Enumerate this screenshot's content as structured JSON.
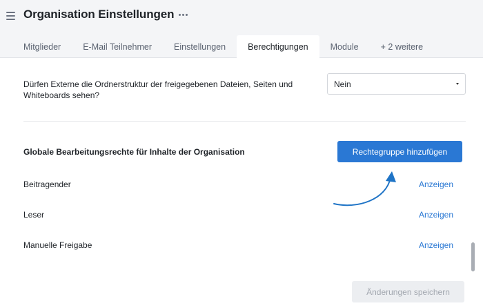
{
  "header": {
    "title": "Organisation Einstellungen",
    "menu_icon": "hamburger-menu-icon",
    "more_icon": "more-horizontal-icon"
  },
  "tabs": [
    {
      "label": "Mitglieder",
      "active": false
    },
    {
      "label": "E-Mail Teilnehmer",
      "active": false
    },
    {
      "label": "Einstellungen",
      "active": false
    },
    {
      "label": "Berechtigungen",
      "active": true
    },
    {
      "label": "Module",
      "active": false
    },
    {
      "label": "+ 2 weitere",
      "active": false
    }
  ],
  "external_structure": {
    "question": "Dürfen Externe die Ordnerstruktur der freigegebenen Dateien, Seiten und Whiteboards sehen?",
    "select_value": "Nein"
  },
  "rights": {
    "section_title": "Globale Bearbeitungsrechte für Inhalte der Organisation",
    "add_button_label": "Rechtegruppe hinzufügen",
    "groups": [
      {
        "label": "Beitragender",
        "action": "Anzeigen"
      },
      {
        "label": "Leser",
        "action": "Anzeigen"
      },
      {
        "label": "Manuelle Freigabe",
        "action": "Anzeigen"
      }
    ]
  },
  "footer": {
    "save_label": "Änderungen speichern",
    "save_disabled": true
  },
  "colors": {
    "accent": "#2a78d4",
    "header_bg": "#f4f5f7",
    "annotation_arrow": "#1f74c6"
  }
}
